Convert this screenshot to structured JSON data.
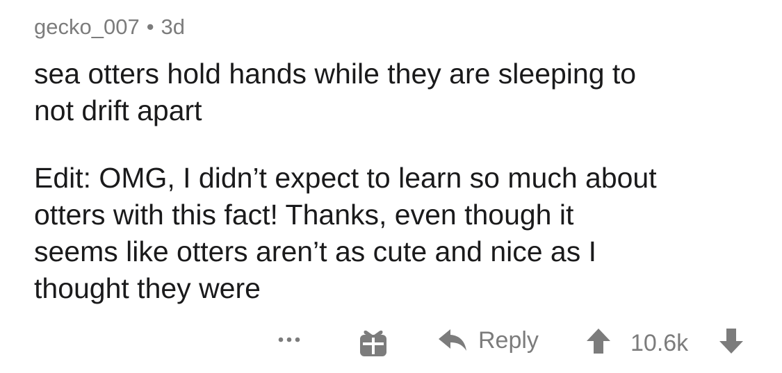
{
  "comment": {
    "author": "gecko_007",
    "separator": "•",
    "age": "3d",
    "paragraphs": [
      "sea otters hold hands while they are sleeping to\nnot drift apart",
      "Edit: OMG, I didn’t expect to learn so much about\notters with this fact! Thanks, even though it\nseems like otters aren’t as cute and nice as I\nthought they were"
    ]
  },
  "actions": {
    "more_icon": "more-horizontal-icon",
    "gift_icon": "gift-icon",
    "reply_icon": "reply-arrow-icon",
    "reply_label": "Reply",
    "upvote_icon": "upvote-arrow-icon",
    "score": "10.6k",
    "downvote_icon": "downvote-arrow-icon"
  },
  "colors": {
    "text": "#1a1a1b",
    "muted": "#7c7c7c",
    "background": "#ffffff"
  }
}
